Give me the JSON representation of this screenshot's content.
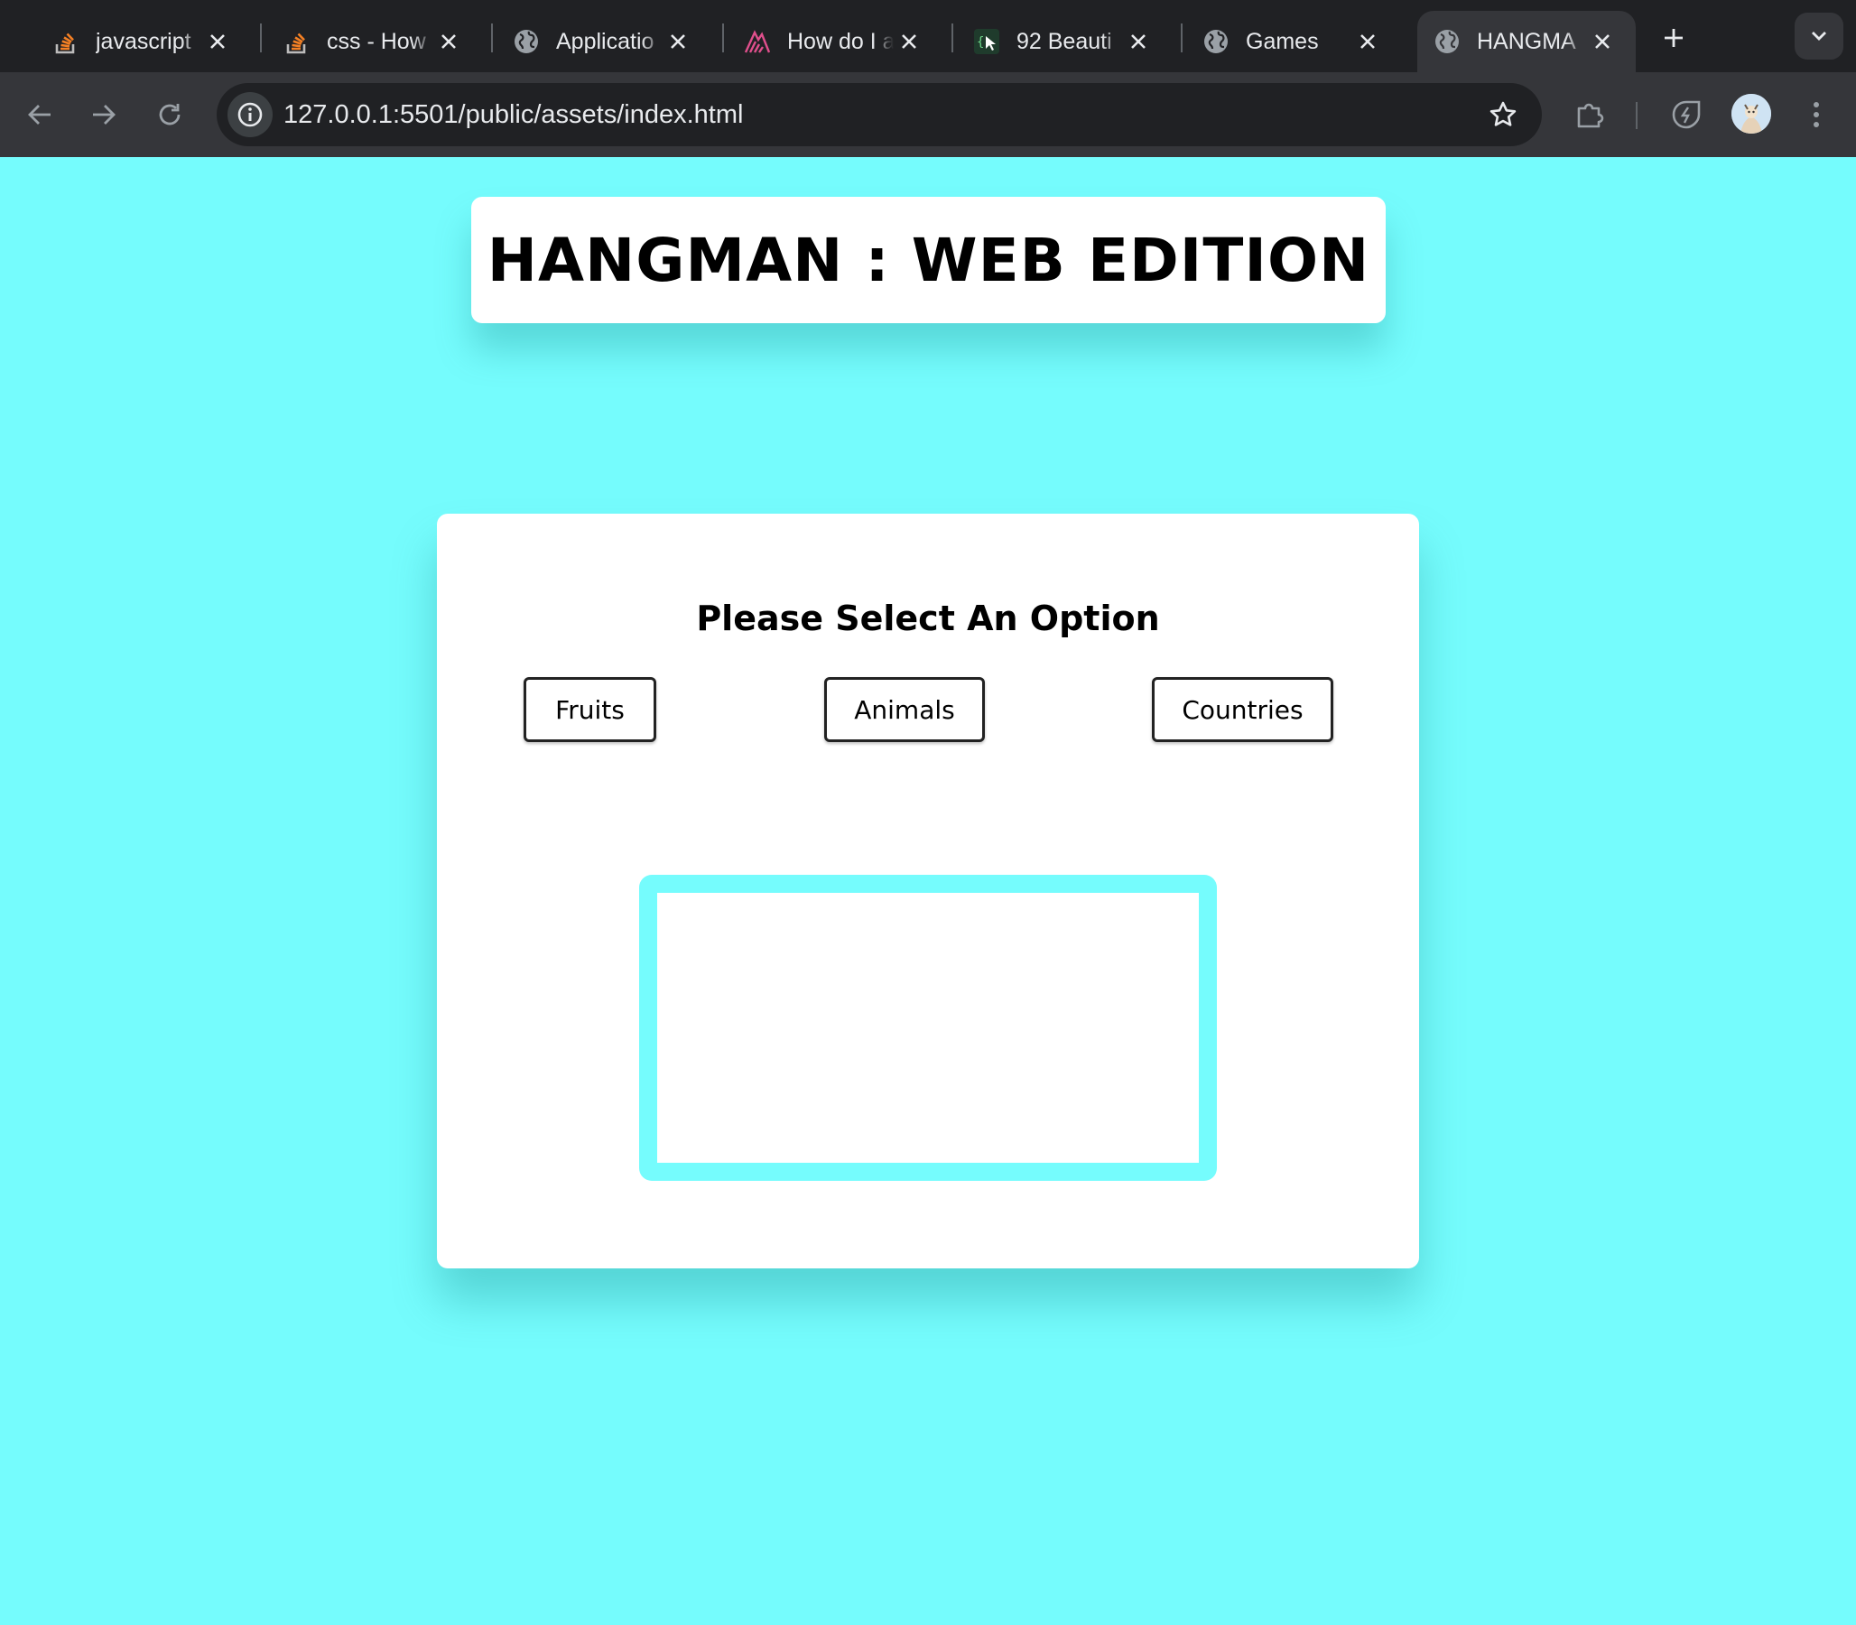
{
  "browser": {
    "tabs": [
      {
        "title": "javascript",
        "icon": "stackoverflow-icon"
      },
      {
        "title": "css - How",
        "icon": "stackoverflow-icon"
      },
      {
        "title": "Applicatio",
        "icon": "globe-icon"
      },
      {
        "title": "How do I a",
        "icon": "sanity-icon"
      },
      {
        "title": "92 Beauti",
        "icon": "cursor-icon"
      },
      {
        "title": "Games",
        "icon": "globe-icon"
      },
      {
        "title": "HANGMA",
        "icon": "globe-icon",
        "active": true
      }
    ],
    "url": "127.0.0.1:5501/public/assets/index.html"
  },
  "page": {
    "title": "HANGMAN : WEB EDITION",
    "prompt": "Please Select An Option",
    "options": [
      "Fruits",
      "Animals",
      "Countries"
    ],
    "background_color": "#75fcfd"
  }
}
